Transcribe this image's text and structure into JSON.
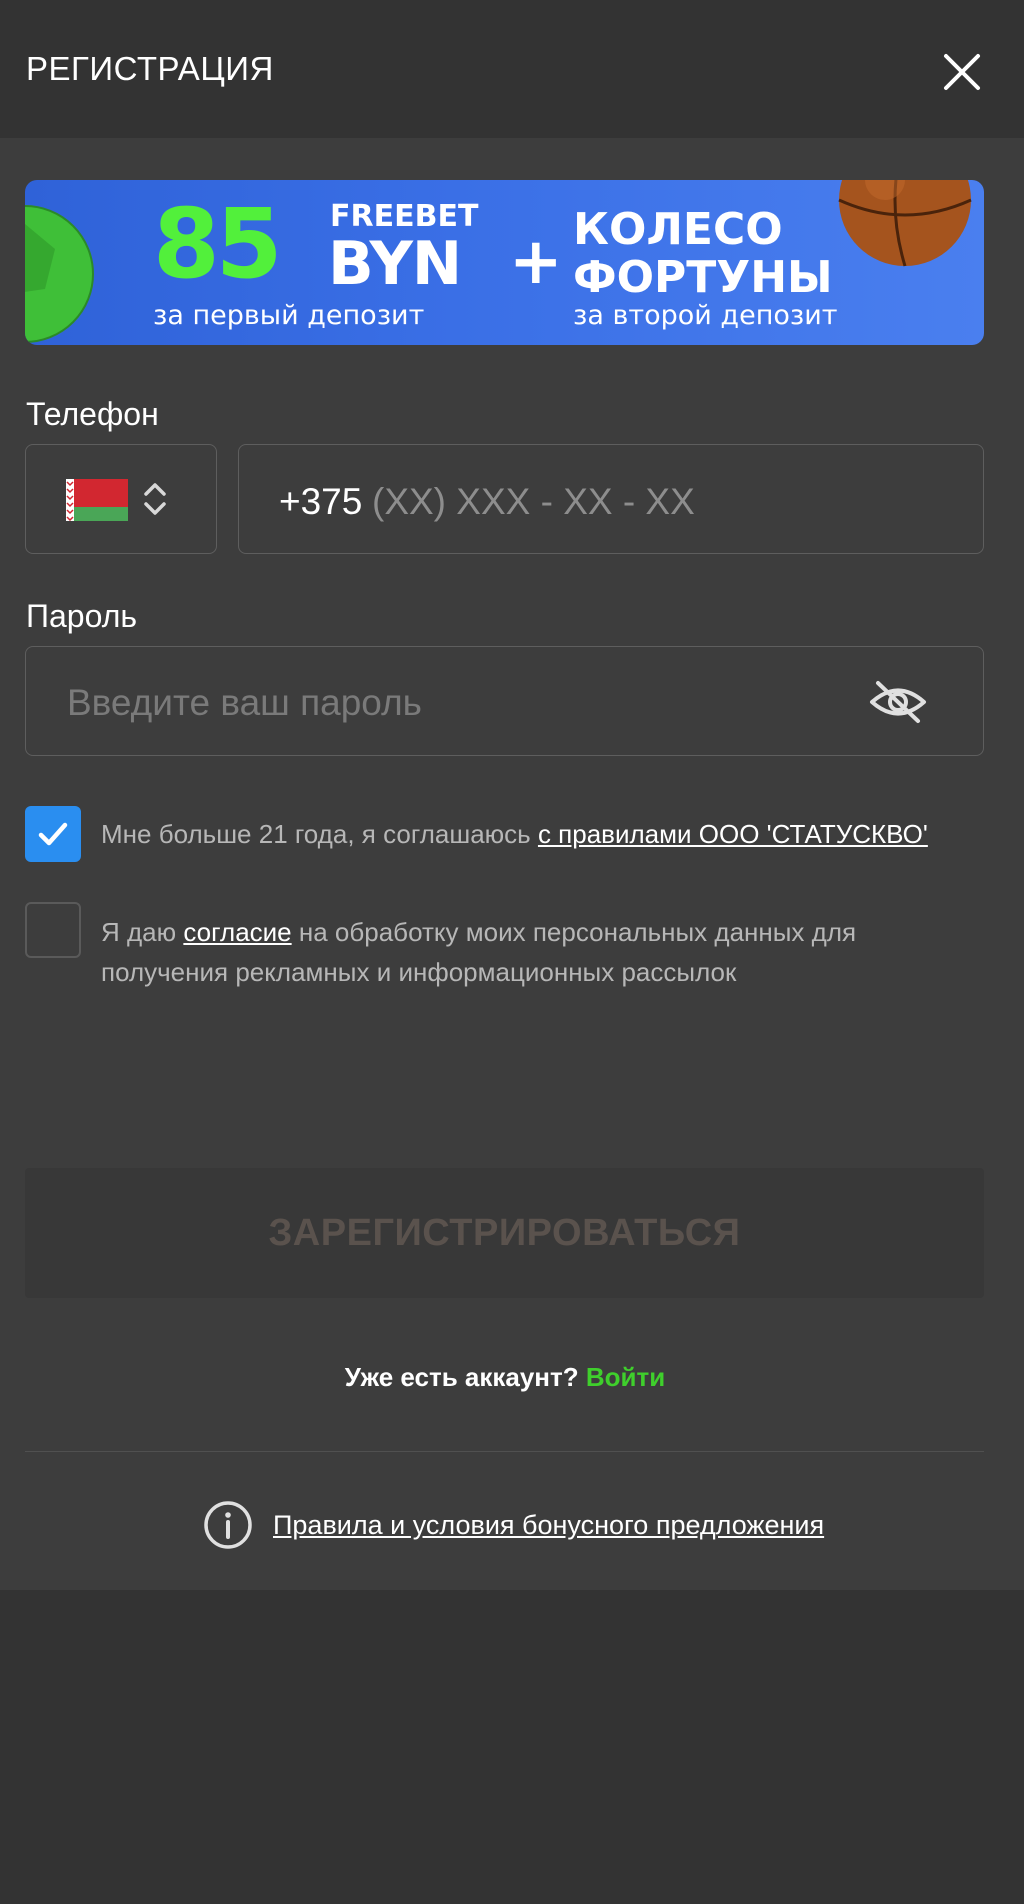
{
  "header": {
    "title": "РЕГИСТРАЦИЯ",
    "close_icon": "close-icon"
  },
  "banner": {
    "amount": "85",
    "freebet": "FREEBET",
    "currency": "BYN",
    "plus": "+",
    "wheel_line1": "КОЛЕСО",
    "wheel_line2": "ФОРТУНЫ",
    "sub_first": "за первый депозит",
    "sub_second": "за второй депозит",
    "colors": {
      "background": "#3a6fe6",
      "accent": "#52f03b"
    }
  },
  "phone": {
    "label": "Телефон",
    "country_flag": "belarus-flag",
    "prefix": "+375",
    "placeholder": "(XX) XXX - XX - XX"
  },
  "password": {
    "label": "Пароль",
    "placeholder": "Введите ваш пароль",
    "visibility_icon": "eye-off-icon"
  },
  "agreements": {
    "age": {
      "checked": true,
      "text": "Мне больше 21 года, я соглашаюсь ",
      "link": "с правилами ООО 'СТАТУСКВО'"
    },
    "marketing": {
      "checked": false,
      "text_before": "Я даю ",
      "link": "согласие",
      "text_after": " на обработку моих персональных данных для получения рекламных и информационных рассылок"
    }
  },
  "register_button": "ЗАРЕГИСТРИРОВАТЬСЯ",
  "login": {
    "question": "Уже есть аккаунт? ",
    "link": "Войти"
  },
  "bonus_terms": {
    "icon": "info-icon",
    "link": "Правила и условия бонусного предложения"
  },
  "colors": {
    "checkbox_accent": "#2a8ef0",
    "login_link": "#3fcf2c",
    "background": "#333333",
    "panel": "#3d3d3d"
  }
}
